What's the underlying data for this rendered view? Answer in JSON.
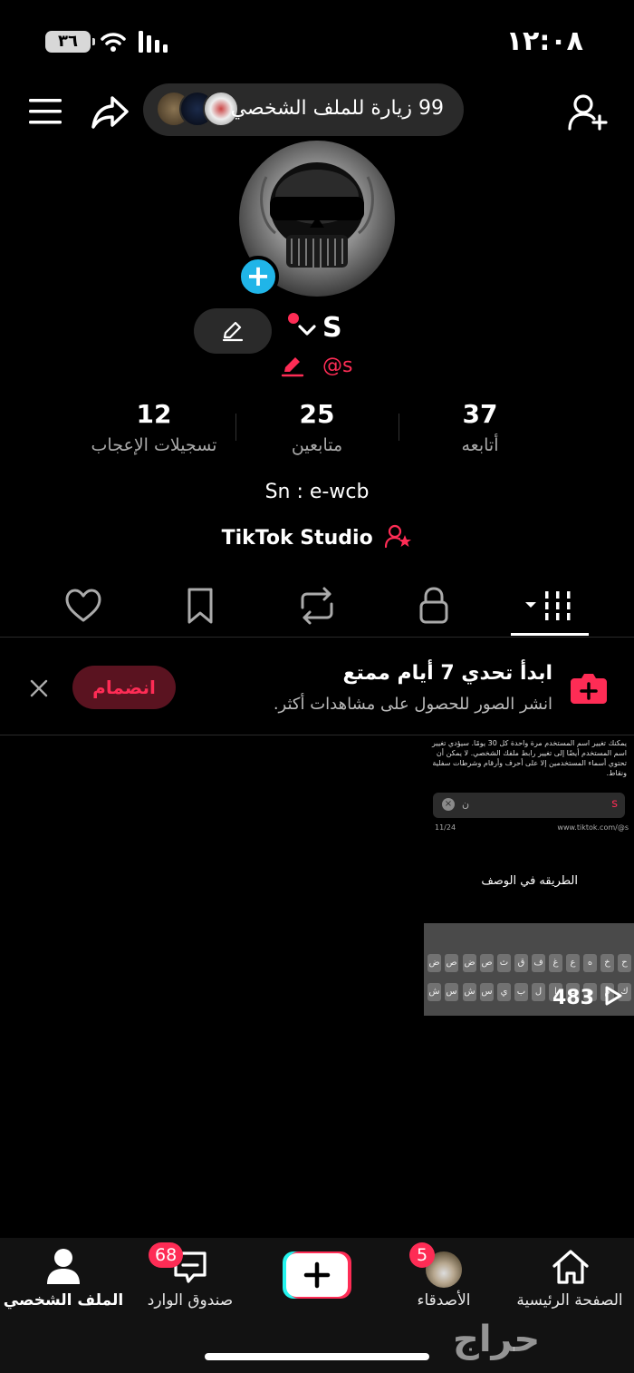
{
  "status_bar": {
    "time": "١٢:٠٨",
    "battery": "٣٦"
  },
  "top_bar": {
    "visits_label": "99 زيارة للملف الشخصي"
  },
  "profile": {
    "name": "S",
    "handle": "@s",
    "bio": "Sn : e-wcb",
    "studio_label": "TikTok Studio"
  },
  "stats": [
    {
      "value": "37",
      "label": "أتابعه"
    },
    {
      "value": "25",
      "label": "متابعين"
    },
    {
      "value": "12",
      "label": "تسجيلات الإعجاب"
    }
  ],
  "challenge": {
    "title": "ابدأ تحدي 7 أيام ممتع",
    "subtitle": "انشر الصور للحصول على مشاهدات أكثر.",
    "join_label": "انضمام"
  },
  "post": {
    "text": "يمكنك تغيير اسم المستخدم مرة واحدة كل 30 يومًا. سيؤدي تغيير اسم المستخدم أيضًا إلى تغيير رابط ملفك الشخصي. لا يمكن أن تحتوي أسماء المستخدمين إلا على أحرف وأرقام وشرطات سفلية ونقاط.",
    "url": "www.tiktok.com/@s",
    "char_count": "11/24",
    "caption": "الطريقه في الوصف",
    "views": "483",
    "keyboard_row1": [
      "ح",
      "خ",
      "ه",
      "ع",
      "غ",
      "ف",
      "ق",
      "ث",
      "ص",
      "ض"
    ],
    "keyboard_row2": [
      "ك",
      "م",
      "ن",
      "ت",
      "ا",
      "ل",
      "ب",
      "ي",
      "س",
      "ش"
    ]
  },
  "bottom_nav": {
    "home": "الصفحة الرئيسية",
    "friends": "الأصدقاء",
    "friends_badge": "5",
    "inbox": "صندوق الوارد",
    "inbox_badge": "68",
    "profile": "الملف الشخصي"
  },
  "watermark": "حراج",
  "colors": {
    "accent": "#fe2c55",
    "cyan": "#20b5e8",
    "background": "#000000"
  }
}
